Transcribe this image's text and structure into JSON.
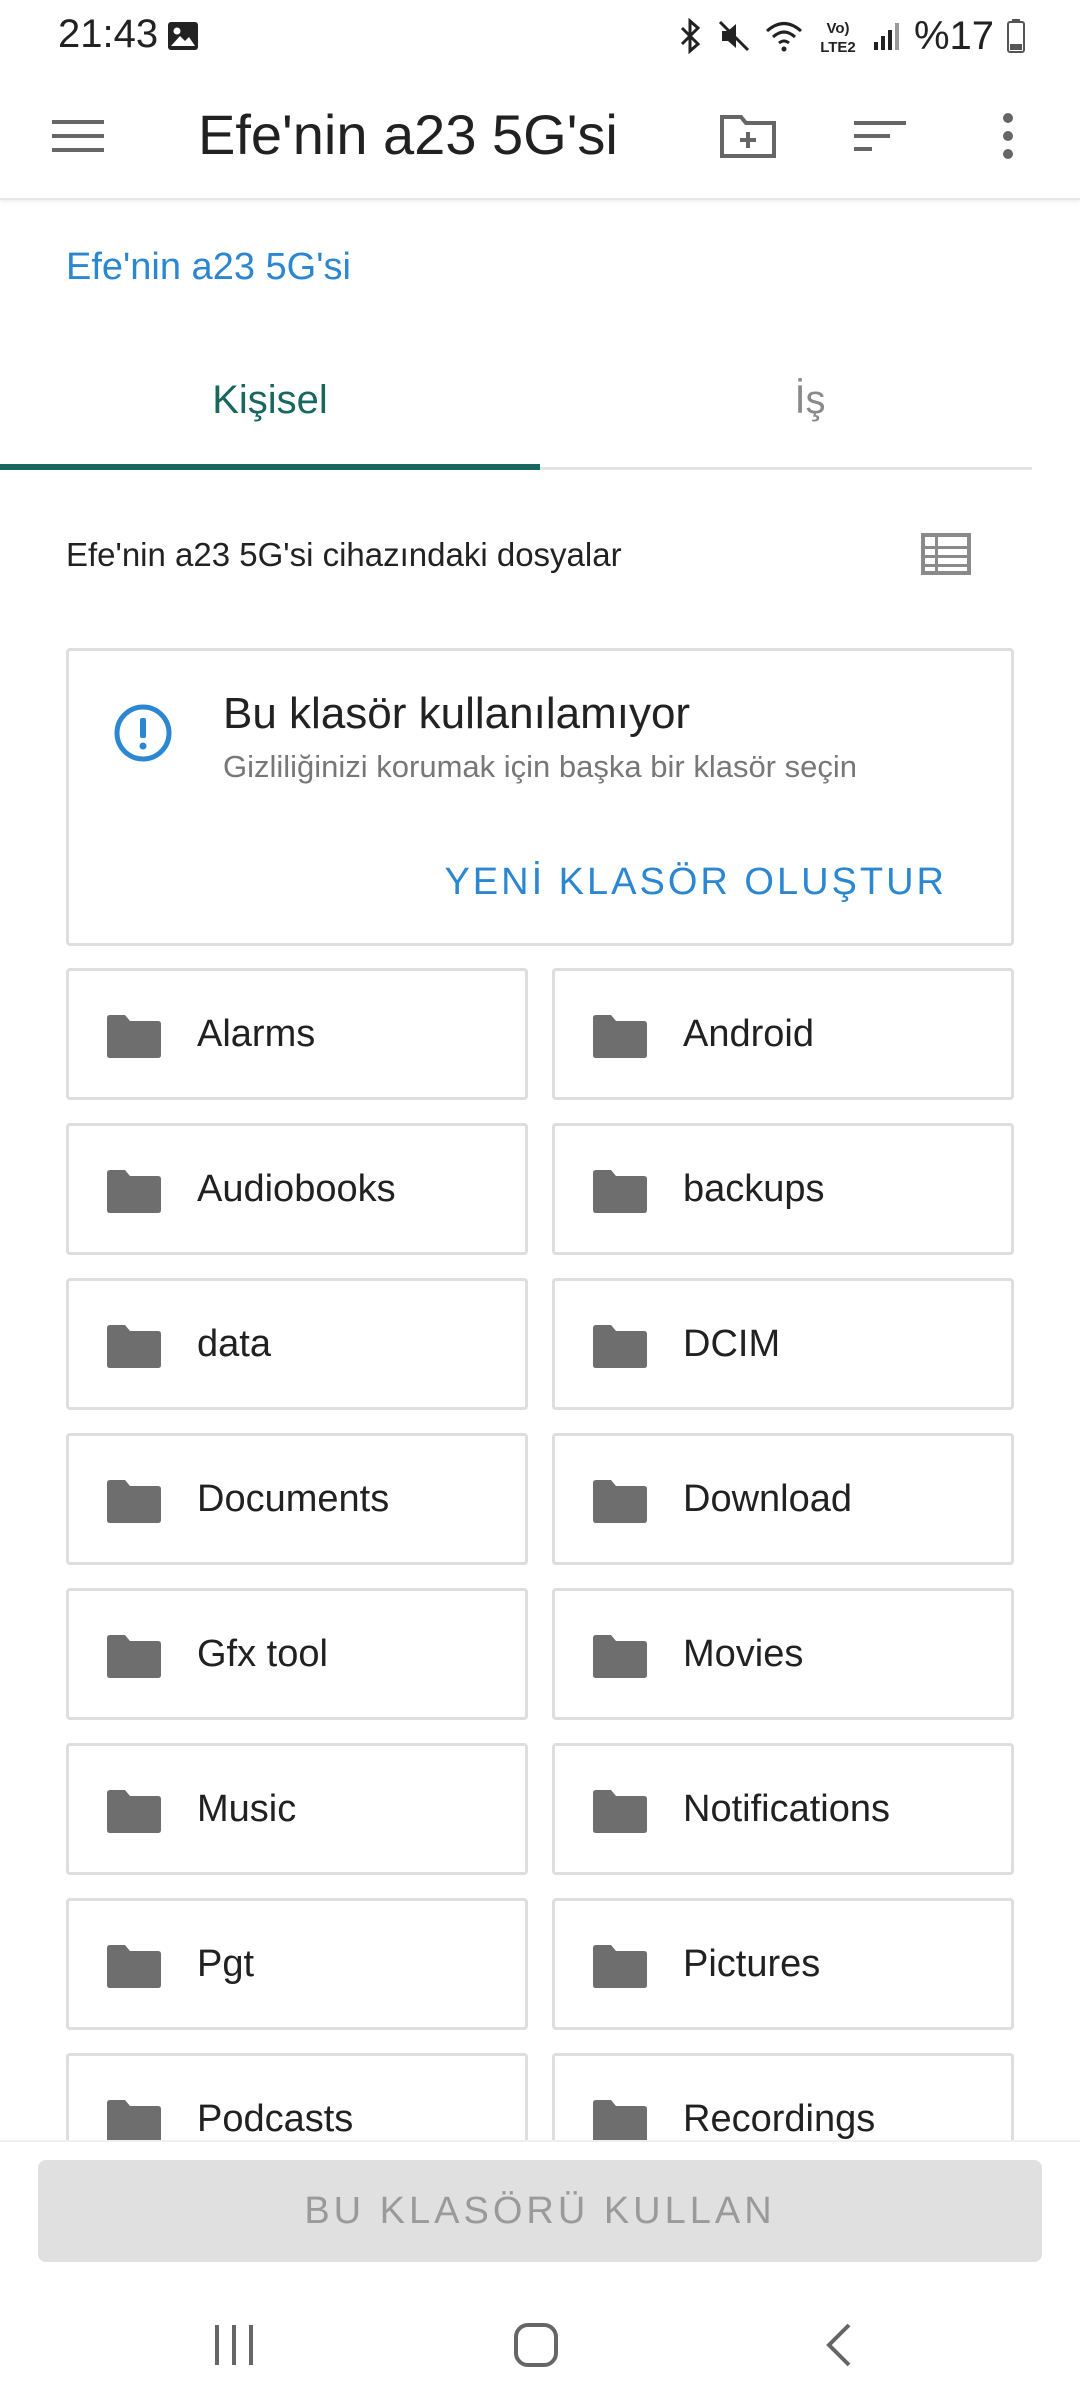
{
  "status_bar": {
    "time": "21:43",
    "battery": "%17",
    "icons": [
      "image-icon",
      "bluetooth-icon",
      "mute-icon",
      "wifi-icon",
      "volte-icon",
      "signal-icon",
      "battery-icon"
    ],
    "volte_label_top": "Vo)",
    "volte_label_bottom": "LTE2"
  },
  "toolbar": {
    "title": "Efe'nin a23 5G'si",
    "icons": [
      "menu-icon",
      "new-folder-icon",
      "sort-icon",
      "more-vert-icon"
    ]
  },
  "breadcrumb": "Efe'nin a23 5G'si",
  "tabs": [
    {
      "label": "Kişisel",
      "selected": true
    },
    {
      "label": "İş",
      "selected": false
    }
  ],
  "files_header": "Efe'nin a23 5G'si cihazındaki dosyalar",
  "warning": {
    "title": "Bu klasör kullanılamıyor",
    "subtitle": "Gizliliğinizi korumak için başka bir klasör seçin",
    "action": "YENİ KLASÖR OLUŞTUR"
  },
  "folders": [
    "Alarms",
    "Android",
    "Audiobooks",
    "backups",
    "data",
    "DCIM",
    "Documents",
    "Download",
    "Gfx tool",
    "Movies",
    "Music",
    "Notifications",
    "Pgt",
    "Pictures",
    "Podcasts",
    "Recordings"
  ],
  "bottom_button": "BU KLASÖRÜ KULLAN",
  "colors": {
    "accent_blue": "#2b87d1",
    "tab_green": "#18685f",
    "folder_gray": "#6e6e6e",
    "disabled_button": "#e0e0e0"
  }
}
